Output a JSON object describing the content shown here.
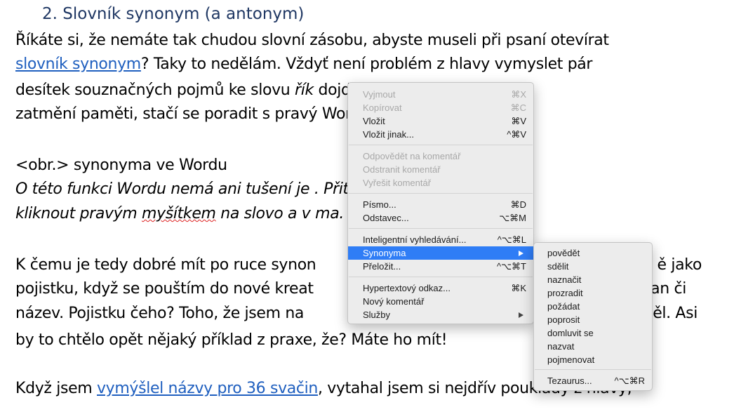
{
  "document": {
    "heading": "2.  Slovník synonym (a antonym)",
    "line1": "Říkáte si, že nemáte tak chudou slovní zásobu, abyste museli při psaní otevírat",
    "line2_link": "slovník synonym",
    "line2_rest": "? Taky to nedělám. Vždyť není problém z hlavy vymyslet pár",
    "line3_a": "desítek souznačných pojmů ke slovu ",
    "line3_b": "řík",
    "line3_c": "                                      dojde na totální",
    "line4_a": "zatmění paměti, stačí se poradit s pravý",
    "line4_b": "                                  Wordu:",
    "line5": "<obr.> synonyma ve Wordu",
    "line6_a": "O této funkci Wordu nemá ani tušení je",
    "line6_b": "                                     . Přitom stačí jen",
    "line7_a": "kliknout pravým ",
    "line7_squiggle": "myšítkem",
    "line7_b": " na slovo a v",
    "line7_c": "                                        ma.",
    "line8_a": "K čemu je tedy dobré mít po ruce synon",
    "line8_b": "ě jako",
    "line9_a": "pojistku, když se pouštím do nové kreat",
    "line9_b": "an či",
    "line10_a": "název. Pojistku čeho? Toho, že jsem na",
    "line10_b": "ěl. Asi",
    "line11": "by to chtělo opět nějaký příklad z praxe, že? Máte ho mít!",
    "line12_a": "Když jsem ",
    "line12_link": "vymýšlel názvy pro 36 svačin",
    "line12_b": ", vytahal jsem si nejdřív pouklady z hlavy,"
  },
  "context_menu": {
    "items": [
      {
        "label": "Vyjmout",
        "shortcut": "⌘X"
      },
      {
        "label": "Kopírovat",
        "shortcut": "⌘C"
      },
      {
        "label": "Vložit",
        "shortcut": "⌘V"
      },
      {
        "label": "Vložit jinak...",
        "shortcut": "^⌘V"
      },
      {
        "label": "Odpovědět na komentář",
        "shortcut": ""
      },
      {
        "label": "Odstranit komentář",
        "shortcut": ""
      },
      {
        "label": "Vyřešit komentář",
        "shortcut": ""
      },
      {
        "label": "Písmo...",
        "shortcut": "⌘D"
      },
      {
        "label": "Odstavec...",
        "shortcut": "⌥⌘M"
      },
      {
        "label": "Inteligentní vyhledávání...",
        "shortcut": "^⌥⌘L"
      },
      {
        "label": "Synonyma",
        "shortcut": ""
      },
      {
        "label": "Přeložit...",
        "shortcut": "^⌥⌘T"
      },
      {
        "label": "Hypertextový odkaz...",
        "shortcut": "⌘K"
      },
      {
        "label": "Nový komentář",
        "shortcut": ""
      },
      {
        "label": "Služby",
        "shortcut": ""
      }
    ]
  },
  "synonym_submenu": {
    "items": [
      "povědět",
      "sdělit",
      "naznačit",
      "prozradit",
      "požádat",
      "poprosit",
      "domluvit se",
      "nazvat",
      "pojmenovat"
    ],
    "thesaurus": {
      "label": "Tezaurus...",
      "shortcut": "^⌥⌘R"
    }
  },
  "colors": {
    "heading": "#1f3763",
    "link": "#1f5fbf",
    "highlight": "#2f7df6"
  }
}
